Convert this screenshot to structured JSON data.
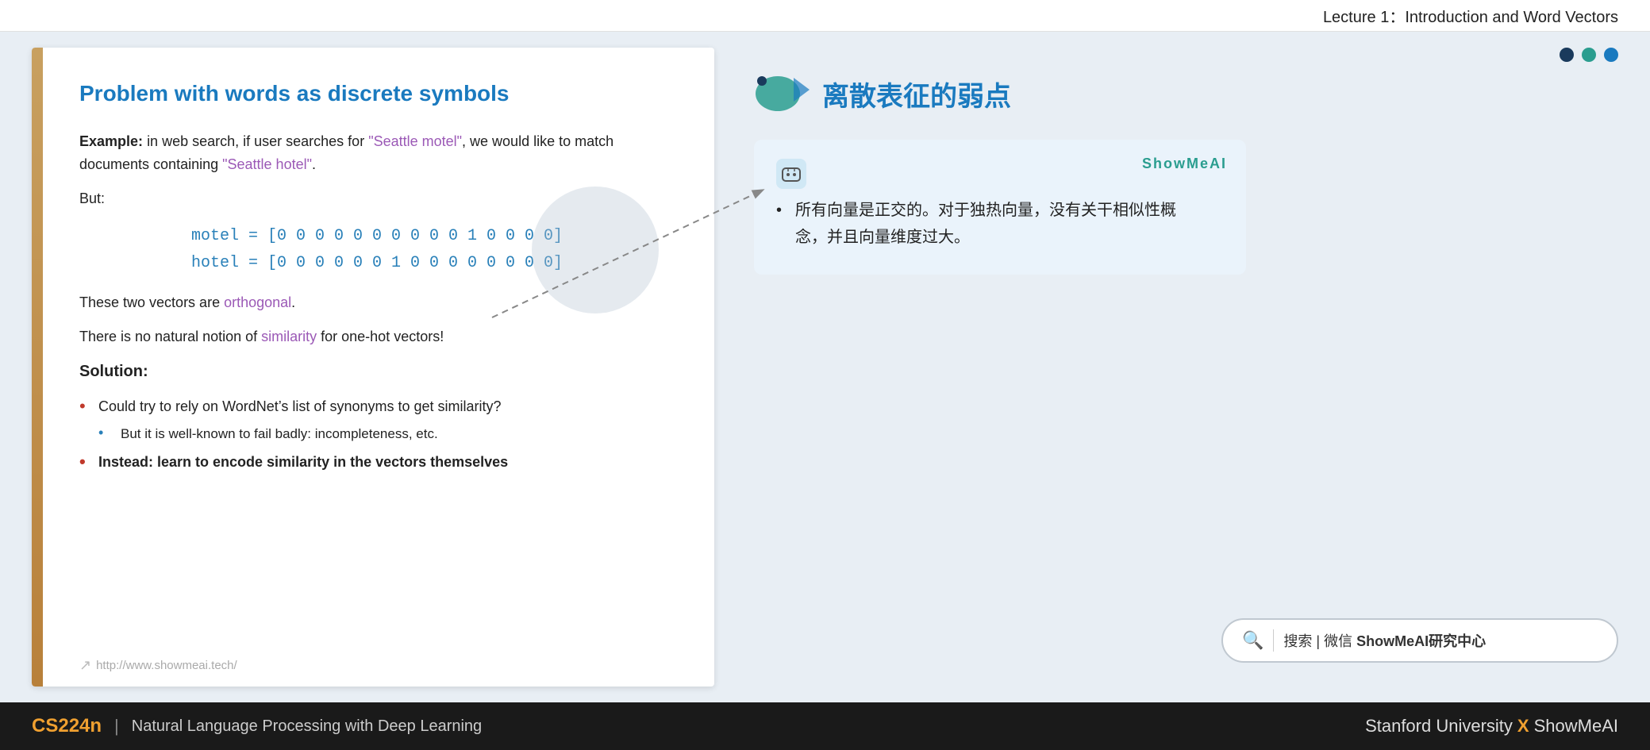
{
  "header": {
    "lecture_title": "Lecture 1：Introduction and Word Vectors"
  },
  "slide": {
    "title": "Problem with words as discrete symbols",
    "example_text": "in web search, if user searches for ",
    "example_quote1": "\"Seattle motel\"",
    "example_mid": ", we would like to match documents containing ",
    "example_quote2": "\"Seattle hotel\"",
    "example_end": ".",
    "but_label": "But:",
    "vector1": "motel = [0 0 0 0 0 0 0 0 0 0 1 0 0 0 0]",
    "vector2": "hotel = [0 0 0 0 0 0 1 0 0 0 0 0 0 0 0]",
    "orthogonal_text": "These two vectors are ",
    "orthogonal_highlight": "orthogonal",
    "orthogonal_end": ".",
    "similarity_text": "There is no natural notion of ",
    "similarity_highlight": "similarity",
    "similarity_end": " for one-hot vectors!",
    "solution_header": "Solution:",
    "bullet1": "Could try to rely on WordNet’s list of synonyms to get similarity?",
    "subbullet1": "But it is well-known to fail badly: incompleteness, etc.",
    "bullet2": "Instead: learn to encode similarity in the vectors themselves",
    "url": "http://www.showmeai.tech/"
  },
  "right_panel": {
    "chinese_title": "离散表征的弱点",
    "annotation_label": "ShowMeAI",
    "annotation_text_line1": "所有向量是正交的。对于独热向量，没有关干相似性概",
    "annotation_text_line2": "念，并且向量维度过大。",
    "search_text": "搜索 | 微信 ",
    "search_bold": "ShowMeAI研究中心",
    "dots": [
      "dark",
      "teal",
      "blue"
    ]
  },
  "footer": {
    "course_id": "CS224n",
    "separator": "|",
    "course_name": "Natural Language Processing with Deep Learning",
    "university": "Stanford University",
    "x_mark": "X",
    "showmeai": "ShowMeAI"
  }
}
